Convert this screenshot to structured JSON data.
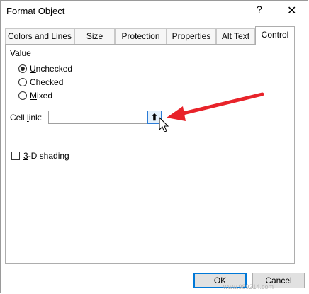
{
  "window": {
    "title": "Format Object",
    "help": "?",
    "close": "✕"
  },
  "tabs": [
    "Colors and Lines",
    "Size",
    "Protection",
    "Properties",
    "Alt Text",
    "Control"
  ],
  "active_tab": "Control",
  "value_group": {
    "label": "Value",
    "options": [
      {
        "pre": "",
        "mnemonic": "U",
        "post": "nchecked",
        "checked": true
      },
      {
        "pre": "",
        "mnemonic": "C",
        "post": "hecked",
        "checked": false
      },
      {
        "pre": "",
        "mnemonic": "M",
        "post": "ixed",
        "checked": false
      }
    ]
  },
  "cell_link": {
    "label_pre": "Cell ",
    "label_mnemonic": "l",
    "label_post": "ink:",
    "value": "",
    "ref_button_icon": "collapse-dialog-icon",
    "ref_button_glyph": "⬆"
  },
  "shading": {
    "label_pre": "",
    "label_mnemonic": "3",
    "label_post": "-D shading",
    "checked": false
  },
  "buttons": {
    "ok": "OK",
    "cancel": "Cancel"
  },
  "watermark": "www.989214.com",
  "colors": {
    "accent": "#0078d7",
    "annotation_arrow": "#e8232a"
  }
}
